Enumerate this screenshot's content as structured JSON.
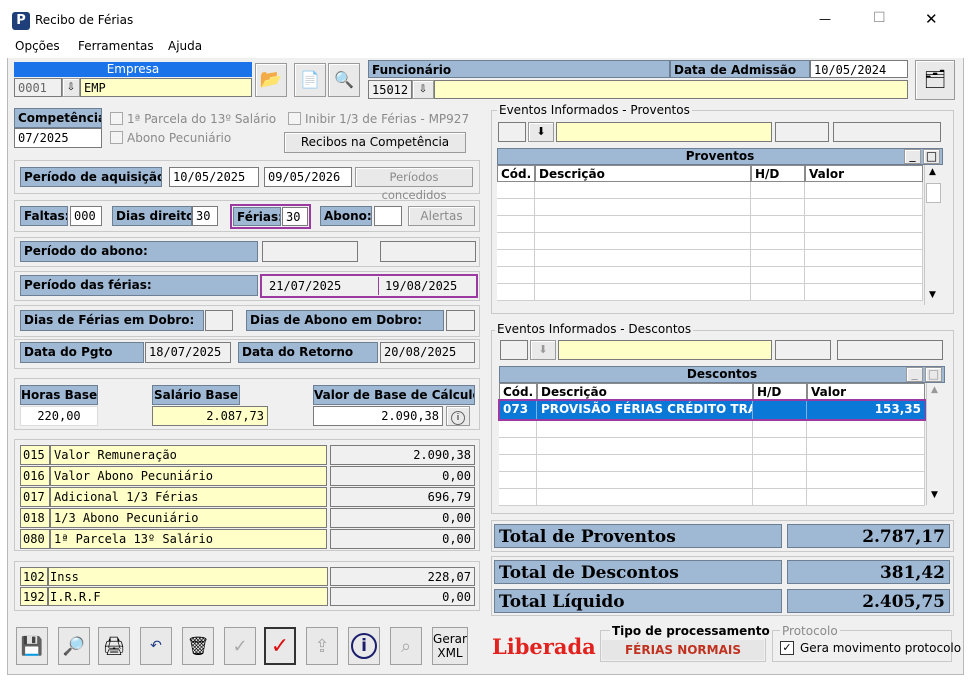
{
  "window": {
    "title": "Recibo de Férias",
    "minimize": "—",
    "maximize": "☐",
    "close": "✕"
  },
  "menu": [
    "Opções",
    "Ferramentas",
    "Ajuda"
  ],
  "empresa": {
    "label": "Empresa",
    "code": "0001",
    "name": "EMP"
  },
  "funcionario": {
    "label": "Funcionário",
    "code": "15012",
    "name": ""
  },
  "admissao": {
    "label": "Data de Admissão",
    "value": "10/05/2024"
  },
  "competencia": {
    "label": "Competência",
    "value": "07/2025"
  },
  "options": {
    "parcela13": "1ª Parcela do 13º Salário",
    "abono": "Abono Pecuniário",
    "inibir": "Inibir 1/3 de Férias - MP927",
    "recibos_btn": "Recibos na Competência"
  },
  "aquisicao": {
    "label": "Período de aquisição:",
    "start": "10/05/2025",
    "end": "09/05/2026",
    "btn": "Períodos concedidos"
  },
  "faltas": {
    "label": "Faltas:",
    "value": "000",
    "dias_label": "Dias direito:",
    "dias_value": "30",
    "ferias_label": "Férias:",
    "ferias_value": "30",
    "abono_label": "Abono:",
    "abono_value": "",
    "alertas_btn": "Alertas"
  },
  "periodo_abono": {
    "label": "Período do abono:"
  },
  "periodo_ferias": {
    "label": "Período das férias:",
    "start": "21/07/2025",
    "end": "19/08/2025"
  },
  "dobro": {
    "ferias_label": "Dias de Férias em Dobro:",
    "abono_label": "Dias de Abono em Dobro:"
  },
  "pagamento": {
    "pgto_label": "Data do Pgto",
    "pgto_value": "18/07/2025",
    "retorno_label": "Data do Retorno",
    "retorno_value": "20/08/2025"
  },
  "base": {
    "horas_label": "Horas Base",
    "horas_value": "220,00",
    "salario_label": "Salário Base",
    "salario_value": "2.087,73",
    "calc_label": "Valor de Base de Cálculo",
    "calc_value": "2.090,38"
  },
  "verbas": [
    {
      "code": "015",
      "desc": "Valor Remuneração",
      "value": "2.090,38"
    },
    {
      "code": "016",
      "desc": "Valor Abono Pecuniário",
      "value": "0,00"
    },
    {
      "code": "017",
      "desc": "Adicional 1/3 Férias",
      "value": "696,79"
    },
    {
      "code": "018",
      "desc": "1/3 Abono Pecuniário",
      "value": "0,00"
    },
    {
      "code": "080",
      "desc": "1ª Parcela 13º Salário",
      "value": "0,00"
    }
  ],
  "descontos_fixos": [
    {
      "code": "102",
      "desc": "Inss",
      "value": "228,07"
    },
    {
      "code": "192",
      "desc": "I.R.R.F",
      "value": "0,00"
    }
  ],
  "proventos": {
    "group": "Eventos Informados - Proventos",
    "title": "Proventos",
    "cols": [
      "Cód.",
      "Descrição",
      "H/D",
      "Valor"
    ]
  },
  "descontos": {
    "group": "Eventos Informados - Descontos",
    "title": "Descontos",
    "cols": [
      "Cód.",
      "Descrição",
      "H/D",
      "Valor"
    ],
    "rows": [
      {
        "code": "073",
        "desc": "PROVISÃO FÉRIAS CRÉDITO TRAB",
        "hd": "",
        "value": "153,35"
      }
    ]
  },
  "totais": {
    "proventos_label": "Total de Proventos",
    "proventos_value": "2.787,17",
    "descontos_label": "Total de Descontos",
    "descontos_value": "381,42",
    "liquido_label": "Total Líquido",
    "liquido_value": "2.405,75"
  },
  "footer": {
    "gerar_xml": "Gerar XML",
    "status": "Liberada",
    "tipo_label": "Tipo de processamento",
    "tipo_value": "FÉRIAS NORMAIS",
    "protocolo_label": "Protocolo",
    "protocolo_check": "Gera movimento protocolo"
  }
}
